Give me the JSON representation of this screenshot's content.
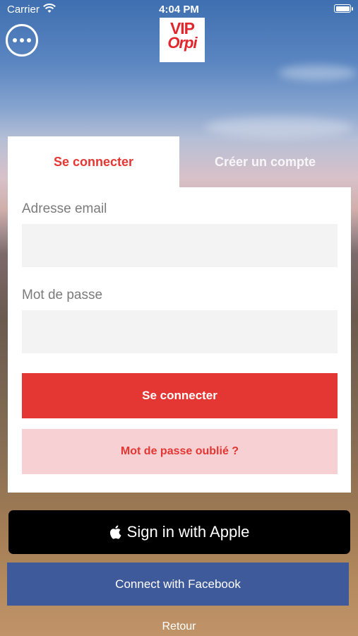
{
  "status_bar": {
    "carrier": "Carrier",
    "time": "4:04 PM"
  },
  "header": {
    "menu_icon": "more-horizontal-icon",
    "logo_line1": "VIP",
    "logo_line2": "Orpi"
  },
  "tabs": [
    {
      "label": "Se connecter",
      "active": true
    },
    {
      "label": "Créer un compte",
      "active": false
    }
  ],
  "form": {
    "email_label": "Adresse email",
    "email_value": "",
    "password_label": "Mot de passe",
    "password_value": "",
    "submit_label": "Se connecter",
    "forgot_label": "Mot de passe oublié ?"
  },
  "social": {
    "apple_label": "Sign in with Apple",
    "facebook_label": "Connect with Facebook"
  },
  "footer": {
    "back_label": "Retour"
  },
  "colors": {
    "accent": "#e43632",
    "accent_light": "#f7d0d3",
    "facebook": "#3e5a9a",
    "apple": "#000000"
  }
}
